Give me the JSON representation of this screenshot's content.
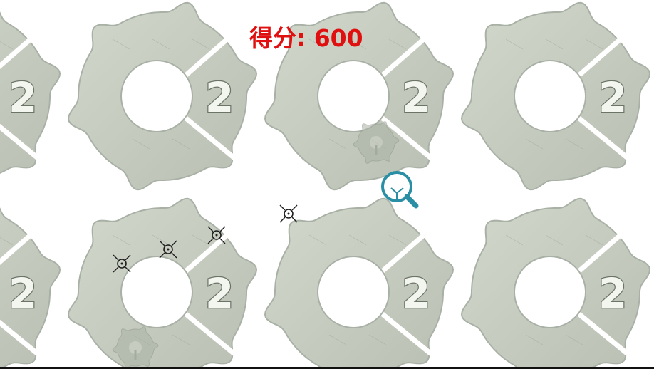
{
  "hud": {
    "score_label": "得分:",
    "score_value": "600"
  },
  "tile": {
    "number": "2",
    "colors": {
      "metal": "#c9cfc2",
      "metal_edge": "#a9b1a6",
      "hole": "#ffffff",
      "number_fill": "#f3f5ef",
      "number_stroke": "#6c7468",
      "marker": "#1e1e1e",
      "pointer": "#2a8fa4"
    }
  },
  "tiles": [
    {
      "name": "gear-tile-r1-c0",
      "slot": "row-1-col-0",
      "number": "2"
    },
    {
      "name": "gear-tile-r1-c1",
      "slot": "row-1-col-1",
      "number": "2"
    },
    {
      "name": "gear-tile-r1-c2",
      "slot": "row-1-col-2",
      "number": "2"
    },
    {
      "name": "gear-tile-r1-c3",
      "slot": "row-1-col-3",
      "number": "2"
    },
    {
      "name": "gear-tile-r2-c0",
      "slot": "row-2-col-0",
      "number": "2"
    },
    {
      "name": "gear-tile-r2-c1",
      "slot": "row-2-col-1",
      "number": "2"
    },
    {
      "name": "gear-tile-r2-c2",
      "slot": "row-2-col-2",
      "number": "2"
    },
    {
      "name": "gear-tile-r2-c3",
      "slot": "row-2-col-3",
      "number": "2"
    }
  ],
  "markers": [
    {
      "name": "target-marker-1",
      "icon": "crosshair-icon"
    },
    {
      "name": "target-marker-2",
      "icon": "crosshair-icon"
    },
    {
      "name": "target-marker-3",
      "icon": "crosshair-icon"
    },
    {
      "name": "target-marker-4",
      "icon": "crosshair-icon"
    }
  ],
  "decor": [
    {
      "name": "small-gear-emblem-1",
      "icon": "gear-key-icon"
    },
    {
      "name": "small-gear-emblem-2",
      "icon": "gear-key-icon"
    }
  ],
  "cursor": {
    "name": "magnifier-cursor",
    "icon": "magnifier-icon"
  }
}
